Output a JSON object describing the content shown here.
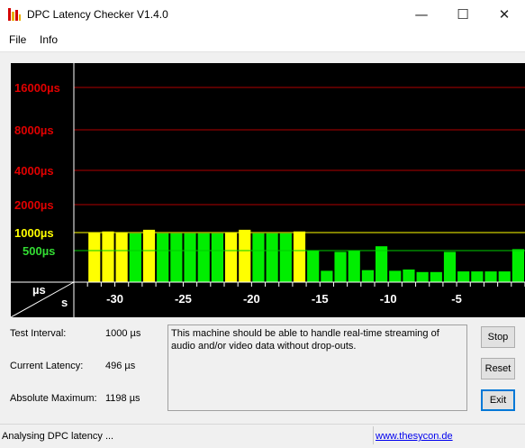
{
  "window": {
    "title": "DPC Latency Checker V1.4.0",
    "minimize_symbol": "—",
    "maximize_symbol": "☐",
    "close_symbol": "✕"
  },
  "menu": [
    "File",
    "Info"
  ],
  "chart_data": {
    "type": "bar",
    "title": "",
    "xlabel": "s",
    "ylabel": "µs",
    "y_tick_labels": [
      "16000µs",
      "8000µs",
      "4000µs",
      "2000µs",
      "1000µs",
      "500µs"
    ],
    "y_tick_values": [
      16000,
      8000,
      4000,
      2000,
      1000,
      500
    ],
    "y_tick_colors": [
      "#e00000",
      "#e00000",
      "#e00000",
      "#e00000",
      "#ffff00",
      "#33dd33"
    ],
    "x_tick_labels": [
      "-30",
      "-25",
      "-20",
      "-15",
      "-10",
      "-5"
    ],
    "x_tick_values": [
      -30,
      -25,
      -20,
      -15,
      -10,
      -5
    ],
    "x_range": [
      -33,
      0
    ],
    "axis_corner_top": "µs",
    "axis_corner_bottom": "s",
    "bar_threshold": 1000,
    "bars": [
      {
        "t": -31.5,
        "v": 1000
      },
      {
        "t": -30.5,
        "v": 1040
      },
      {
        "t": -29.5,
        "v": 1000
      },
      {
        "t": -28.5,
        "v": 980
      },
      {
        "t": -27.5,
        "v": 1100
      },
      {
        "t": -26.5,
        "v": 980
      },
      {
        "t": -25.5,
        "v": 980
      },
      {
        "t": -24.5,
        "v": 980
      },
      {
        "t": -23.5,
        "v": 980
      },
      {
        "t": -22.5,
        "v": 980
      },
      {
        "t": -21.5,
        "v": 1010
      },
      {
        "t": -20.5,
        "v": 1100
      },
      {
        "t": -19.5,
        "v": 980
      },
      {
        "t": -18.5,
        "v": 980
      },
      {
        "t": -17.5,
        "v": 980
      },
      {
        "t": -16.5,
        "v": 1040
      },
      {
        "t": -15.5,
        "v": 510
      },
      {
        "t": -14.5,
        "v": 180
      },
      {
        "t": -13.5,
        "v": 480
      },
      {
        "t": -12.5,
        "v": 510
      },
      {
        "t": -11.5,
        "v": 190
      },
      {
        "t": -10.5,
        "v": 620
      },
      {
        "t": -9.5,
        "v": 180
      },
      {
        "t": -8.5,
        "v": 200
      },
      {
        "t": -7.5,
        "v": 160
      },
      {
        "t": -6.5,
        "v": 160
      },
      {
        "t": -5.5,
        "v": 480
      },
      {
        "t": -4.5,
        "v": 170
      },
      {
        "t": -3.5,
        "v": 170
      },
      {
        "t": -2.5,
        "v": 170
      },
      {
        "t": -1.5,
        "v": 170
      },
      {
        "t": -0.5,
        "v": 540
      }
    ],
    "colors": {
      "high": "#ffff00",
      "low": "#00ee00",
      "grid_red": "#b00000",
      "grid_yellow": "#ffff00",
      "grid_green": "#00cc00",
      "background": "#000000",
      "axis": "#ffffff"
    }
  },
  "info": {
    "test_interval_label": "Test Interval:",
    "test_interval_value": "1000 µs",
    "current_latency_label": "Current Latency:",
    "current_latency_value": "496 µs",
    "absolute_maximum_label": "Absolute Maximum:",
    "absolute_maximum_value": "1198 µs"
  },
  "message": "This machine should be able to handle real-time streaming of audio and/or video data without drop-outs.",
  "buttons": {
    "stop": "Stop",
    "reset": "Reset",
    "exit": "Exit"
  },
  "status": {
    "text": "Analysing DPC latency ...",
    "link": "www.thesycon.de"
  }
}
